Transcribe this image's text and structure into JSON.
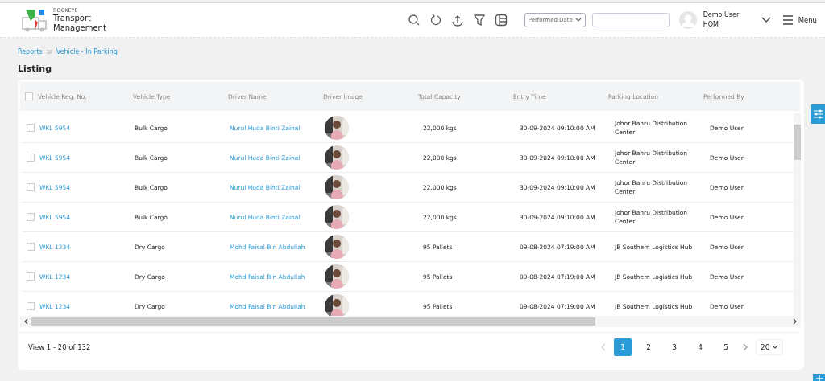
{
  "header": {
    "brand": "ROCKEYE",
    "title": "Transport Management",
    "toolbar": [
      {
        "kind": "search"
      },
      {
        "kind": "refresh"
      },
      {
        "kind": "upload"
      },
      {
        "kind": "filter"
      },
      {
        "kind": "columns"
      }
    ],
    "date_select": {
      "value": "Performed Date"
    },
    "user": {
      "name": "Demo User",
      "role": "HOM"
    },
    "menu": {
      "label": "Menu"
    }
  },
  "breadcrumb": [
    {
      "label": "Reports"
    },
    {
      "label": "Vehicle - In Parking"
    }
  ],
  "page_title": "Listing",
  "table": {
    "select_all_checked": false,
    "columns": [
      "Vehicle Reg. No.",
      "Vehicle Type",
      "Driver Name",
      "Driver Image",
      "Total Capacity",
      "Entry Time",
      "Parking Location",
      "Performed By"
    ],
    "rows": [
      {
        "checked": false,
        "reg": "WKL 5954",
        "type": "Bulk Cargo",
        "driver": "Nurul Huda Binti Zainal",
        "capacity": "22,000 kgs",
        "entry_time": "30-09-2024 09:10:00 AM",
        "location": "Johor Bahru Distribution Center",
        "performed_by": "Demo User"
      },
      {
        "checked": false,
        "reg": "WKL 5954",
        "type": "Bulk Cargo",
        "driver": "Nurul Huda Binti Zainal",
        "capacity": "22,000 kgs",
        "entry_time": "30-09-2024 09:10:00 AM",
        "location": "Johor Bahru Distribution Center",
        "performed_by": "Demo User"
      },
      {
        "checked": false,
        "reg": "WKL 5954",
        "type": "Bulk Cargo",
        "driver": "Nurul Huda Binti Zainal",
        "capacity": "22,000 kgs",
        "entry_time": "30-09-2024 09:10:00 AM",
        "location": "Johor Bahru Distribution Center",
        "performed_by": "Demo User"
      },
      {
        "checked": false,
        "reg": "WKL 5954",
        "type": "Bulk Cargo",
        "driver": "Nurul Huda Binti Zainal",
        "capacity": "22,000 kgs",
        "entry_time": "30-09-2024 09:10:00 AM",
        "location": "Johor Bahru Distribution Center",
        "performed_by": "Demo User"
      },
      {
        "checked": false,
        "reg": "WKL 1234",
        "type": "Dry Cargo",
        "driver": "Mohd Faisal Bin Abdullah",
        "capacity": "95 Pallets",
        "entry_time": "09-08-2024 07:19:00 AM",
        "location": "JB Southern Logistics Hub",
        "performed_by": "Demo User"
      },
      {
        "checked": false,
        "reg": "WKL 1234",
        "type": "Dry Cargo",
        "driver": "Mohd Faisal Bin Abdullah",
        "capacity": "95 Pallets",
        "entry_time": "09-08-2024 07:19:00 AM",
        "location": "JB Southern Logistics Hub",
        "performed_by": "Demo User"
      },
      {
        "checked": false,
        "reg": "WKL 1234",
        "type": "Dry Cargo",
        "driver": "Mohd Faisal Bin Abdullah",
        "capacity": "95 Pallets",
        "entry_time": "09-08-2024 07:19:00 AM",
        "location": "JB Southern Logistics Hub",
        "performed_by": "Demo User"
      }
    ]
  },
  "pagination": {
    "summary": "View 1 - 20 of 132",
    "pages": [
      {
        "label": "1",
        "selected": true
      },
      {
        "label": "2",
        "selected": false
      },
      {
        "label": "3",
        "selected": false
      },
      {
        "label": "4",
        "selected": false
      },
      {
        "label": "5",
        "selected": false
      }
    ],
    "page_size": "20"
  }
}
